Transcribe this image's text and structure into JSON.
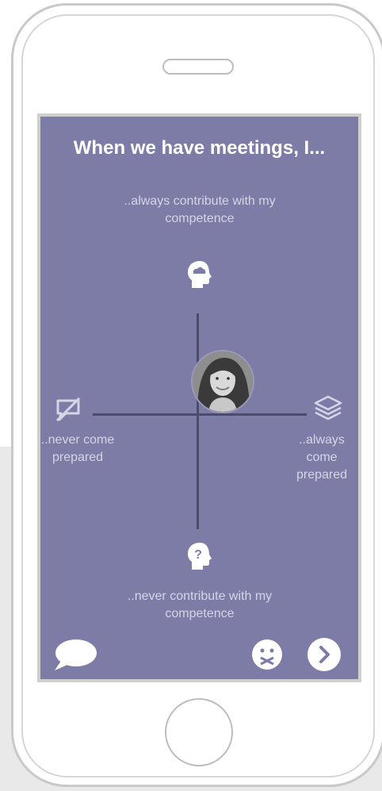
{
  "question": {
    "title": "When we have meetings, I..."
  },
  "axes": {
    "top": "..always contribute with my competence",
    "bottom": "..never contribute with my competence",
    "left": "..never come prepared",
    "right": "..always come prepared"
  },
  "icons": {
    "top": "head-cloud-icon",
    "bottom": "head-question-icon",
    "left": "no-chat-icon",
    "right": "layers-icon",
    "chat": "chat-bubble-icon",
    "sad": "sad-face-icon",
    "next": "chevron-right-icon"
  },
  "colors": {
    "screen_bg": "#7c7ca7",
    "label_text": "#d5d5e6",
    "title_text": "#ffffff",
    "axis": "#4b4b6c"
  }
}
